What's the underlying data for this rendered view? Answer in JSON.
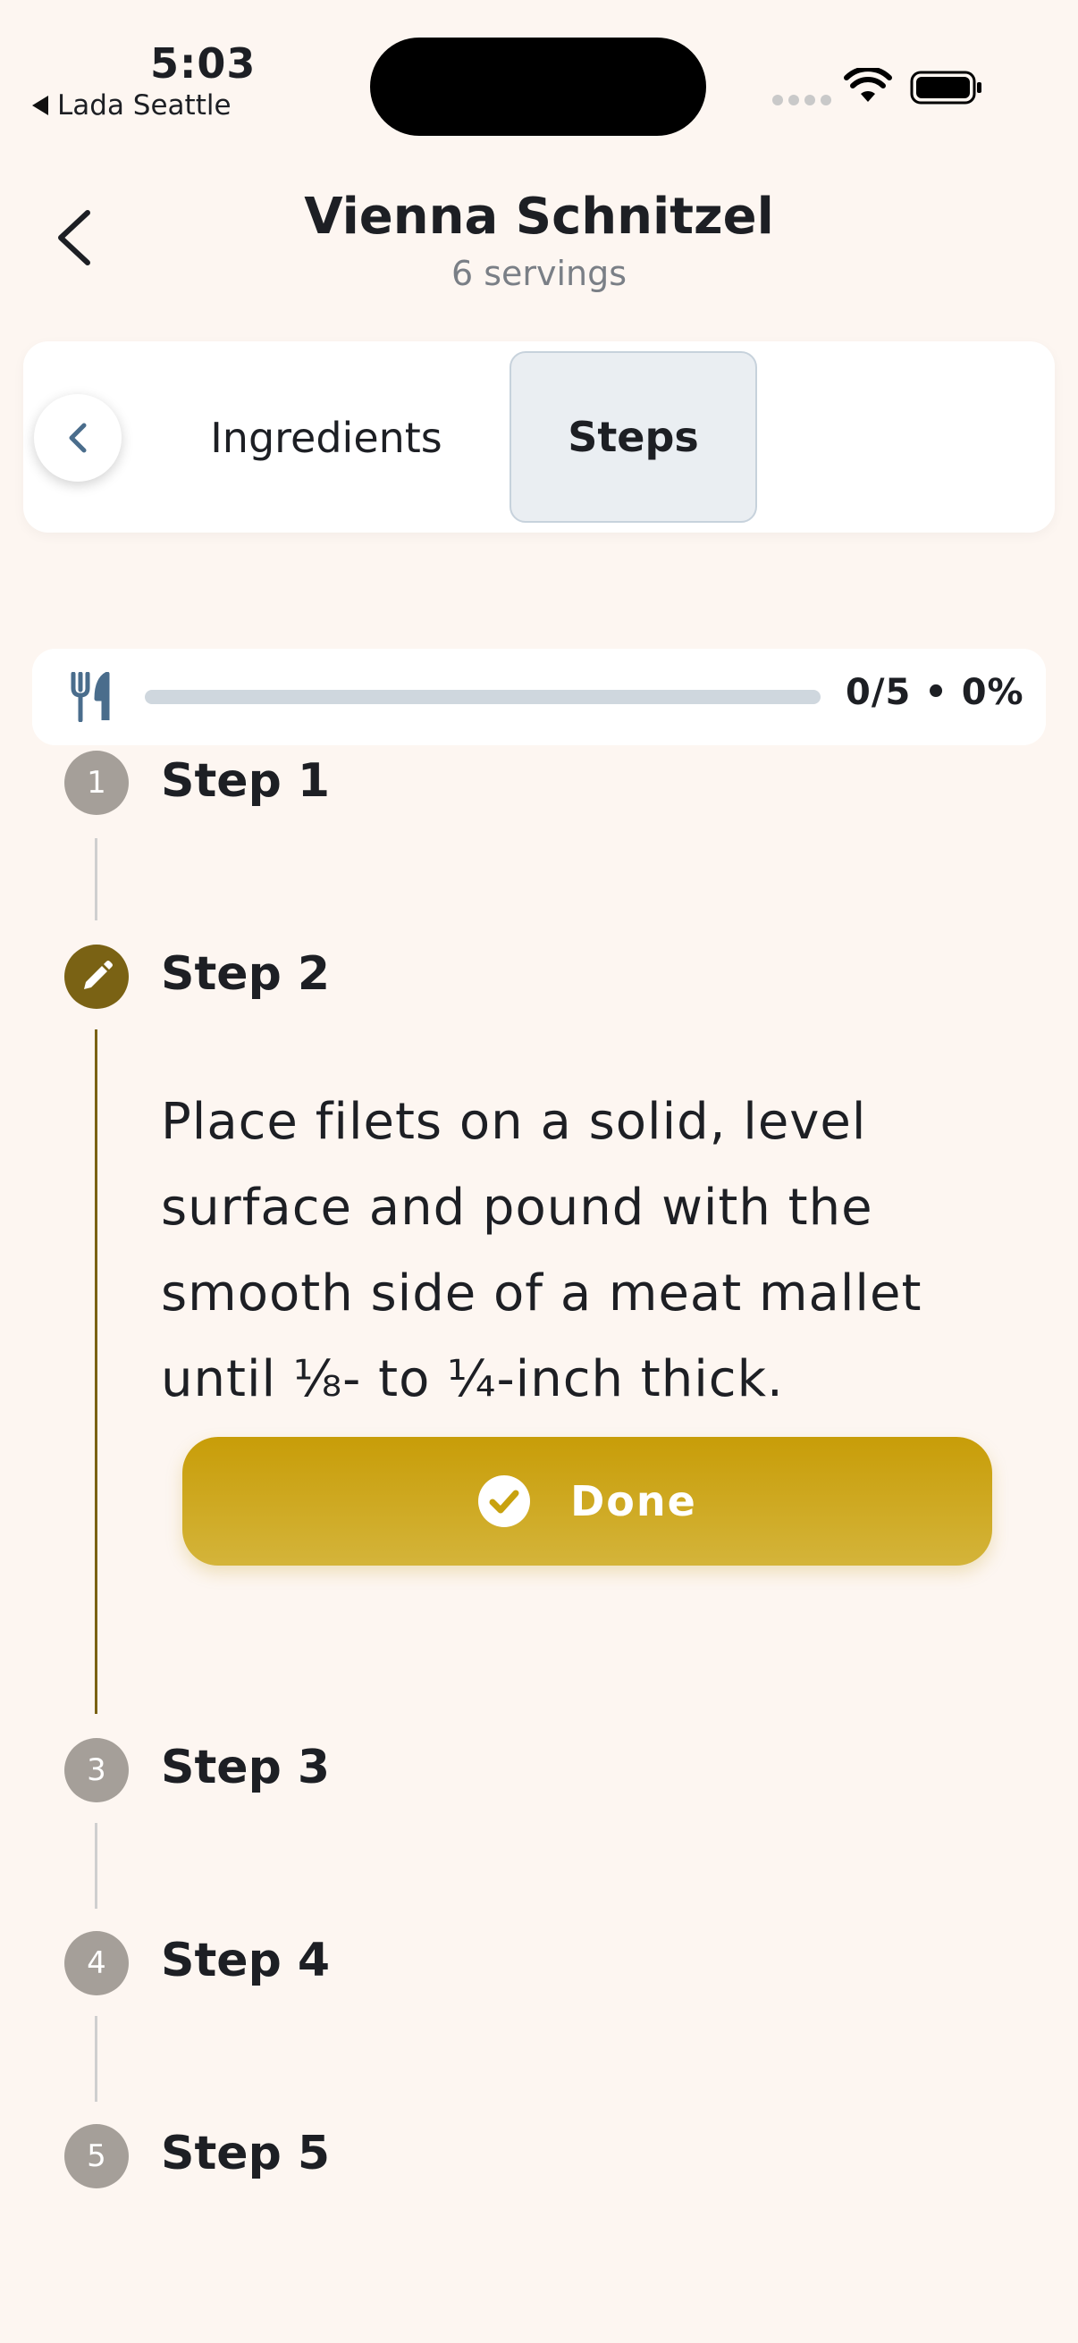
{
  "status_bar": {
    "time": "5:03",
    "back_app": "Lada Seattle"
  },
  "header": {
    "title": "Vienna Schnitzel",
    "subtitle": "6 servings"
  },
  "tabs": {
    "items": [
      {
        "label": "Ingredients",
        "selected": false
      },
      {
        "label": "Steps",
        "selected": true
      }
    ]
  },
  "progress": {
    "text": "0/5 • 0%",
    "fraction": 0
  },
  "steps": [
    {
      "number": "1",
      "label": "Step 1",
      "state": "collapsed"
    },
    {
      "number": "2",
      "label": "Step 2",
      "state": "active",
      "icon": "pencil-icon"
    },
    {
      "number": "3",
      "label": "Step 3",
      "state": "collapsed"
    },
    {
      "number": "4",
      "label": "Step 4",
      "state": "collapsed"
    },
    {
      "number": "5",
      "label": "Step 5",
      "state": "collapsed"
    }
  ],
  "active_step": {
    "instruction": "Place filets on a solid, level surface and pound with the smooth side of a meat mallet until ⅛- to ¼-inch thick.",
    "done_label": "Done"
  },
  "colors": {
    "background": "#fdf6f1",
    "accent_gold": "#c8a20f",
    "active_step": "#7a6214",
    "inactive_step": "#a59f99",
    "icon_blue": "#4a6d8c"
  }
}
